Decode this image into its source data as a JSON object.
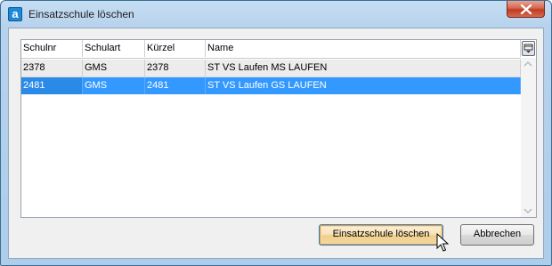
{
  "window": {
    "title": "Einsatzschule löschen",
    "app_icon_letter": "a"
  },
  "table": {
    "columns": [
      "Schulnr",
      "Schulart",
      "Kürzel",
      "Name"
    ],
    "rows": [
      [
        "2378",
        "GMS",
        "2378",
        "ST VS Laufen MS LAUFEN"
      ],
      [
        "2481",
        "GMS",
        "2481",
        "ST VS Laufen GS LAUFEN"
      ]
    ],
    "selected_row": 1
  },
  "buttons": {
    "delete_label": "Einsatzschule löschen",
    "cancel_label": "Abbrechen"
  },
  "colors": {
    "selection": "#3399ff",
    "title_bar": "#b7d2ec",
    "close_button": "#c23a1f"
  }
}
